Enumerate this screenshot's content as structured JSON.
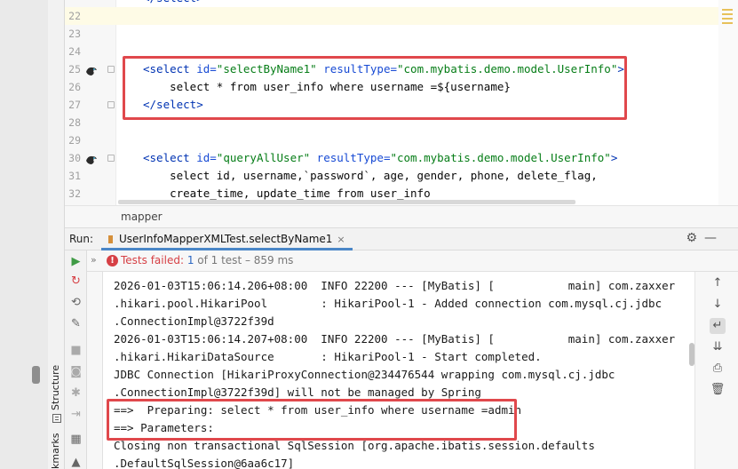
{
  "sidebar": {
    "structure_label": "Structure",
    "bookmarks_label": "kmarks"
  },
  "editor": {
    "lines": [
      {
        "num": "22",
        "code": ""
      },
      {
        "num": "23",
        "code": ""
      },
      {
        "num": "24",
        "code": ""
      },
      {
        "num": "25",
        "open": "<select",
        "a1": " id=",
        "v1": "\"selectByName1\"",
        "a2": " resultType=",
        "v2": "\"com.mybatis.demo.model.UserInfo\"",
        "close": ">"
      },
      {
        "num": "26",
        "code": "    select * from user_info where username =${username}"
      },
      {
        "num": "27",
        "endtag": "</select>"
      },
      {
        "num": "28",
        "code": ""
      },
      {
        "num": "29",
        "code": ""
      },
      {
        "num": "30",
        "open": "<select",
        "a1": " id=",
        "v1": "\"queryAllUser\"",
        "a2": " resultType=",
        "v2": "\"com.mybatis.demo.model.UserInfo\"",
        "close": ">"
      },
      {
        "num": "31",
        "code": "    select id, username,`password`, age, gender, phone, delete_flag,"
      },
      {
        "num": "32",
        "code": "    create_time, update_time from user_info"
      }
    ],
    "top_partial": "</select>"
  },
  "breadcrumb": {
    "item": "mapper"
  },
  "run": {
    "label": "Run:",
    "tab_label": "UserInfoMapperXMLTest.selectByName1",
    "tab_close": "×",
    "status_prefix": "Tests failed: ",
    "status_count": "1",
    "status_rest": " of 1 test – 859 ms"
  },
  "console": {
    "lines": [
      "2026-01-03T15:06:14.206+08:00  INFO 22200 --- [MyBatis] [           main] com.zaxxer",
      ".hikari.pool.HikariPool        : HikariPool-1 - Added connection com.mysql.cj.jdbc",
      ".ConnectionImpl@3722f39d",
      "2026-01-03T15:06:14.207+08:00  INFO 22200 --- [MyBatis] [           main] com.zaxxer",
      ".hikari.HikariDataSource       : HikariPool-1 - Start completed.",
      "JDBC Connection [HikariProxyConnection@234476544 wrapping com.mysql.cj.jdbc",
      ".ConnectionImpl@3722f39d] will not be managed by Spring",
      "==>  Preparing: select * from user_info where username =admin",
      "==> Parameters: ",
      "Closing non transactional SqlSession [org.apache.ibatis.session.defaults",
      ".DefaultSqlSession@6aa6c17]"
    ]
  },
  "colors": {
    "highlight_red": "#e0484c",
    "tag_blue": "#0033b3",
    "attr_blue": "#174ad4",
    "value_green": "#067d17",
    "fail_red": "#d64045"
  }
}
